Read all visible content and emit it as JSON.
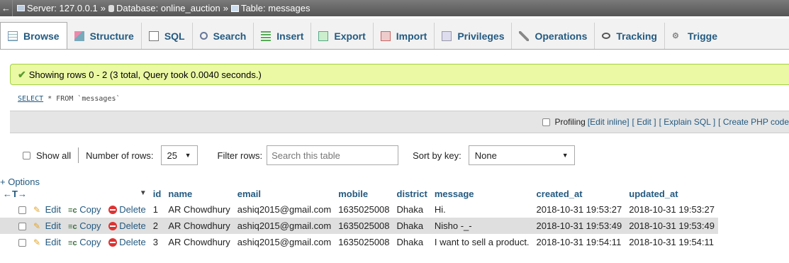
{
  "breadcrumb": {
    "back": "←",
    "server": "Server: 127.0.0.1",
    "database": "Database: online_auction",
    "table": "Table: messages",
    "sep": "»"
  },
  "tabs": [
    {
      "label": "Browse",
      "icon": "browse-icon"
    },
    {
      "label": "Structure",
      "icon": "structure-icon"
    },
    {
      "label": "SQL",
      "icon": "sql-icon"
    },
    {
      "label": "Search",
      "icon": "search-icon"
    },
    {
      "label": "Insert",
      "icon": "insert-icon"
    },
    {
      "label": "Export",
      "icon": "export-icon"
    },
    {
      "label": "Import",
      "icon": "import-icon"
    },
    {
      "label": "Privileges",
      "icon": "privileges-icon"
    },
    {
      "label": "Operations",
      "icon": "operations-icon"
    },
    {
      "label": "Tracking",
      "icon": "tracking-icon"
    },
    {
      "label": "Trigge",
      "icon": "triggers-icon"
    }
  ],
  "success": "Showing rows 0 - 2 (3 total, Query took 0.0040 seconds.)",
  "sql": {
    "select": "SELECT",
    "rest": " * FROM ",
    "table": "`messages`"
  },
  "profiling": {
    "label": "Profiling",
    "edit_inline": "[Edit inline]",
    "edit": "[ Edit ]",
    "explain": "[ Explain SQL ]",
    "php": "[ Create PHP code"
  },
  "nav": {
    "show_all": "Show all",
    "num_rows_label": "Number of rows:",
    "num_rows_value": "25",
    "filter_label": "Filter rows:",
    "filter_placeholder": "Search this table",
    "sort_label": "Sort by key:",
    "sort_value": "None"
  },
  "options": "+ Options",
  "arrows": "←T→",
  "columns": [
    "id",
    "name",
    "email",
    "mobile",
    "district",
    "message",
    "created_at",
    "updated_at"
  ],
  "actions": {
    "edit": "Edit",
    "copy": "Copy",
    "delete": "Delete"
  },
  "rows": [
    {
      "id": "1",
      "name": "AR Chowdhury",
      "email": "ashiq2015@gmail.com",
      "mobile": "1635025008",
      "district": "Dhaka",
      "message": "Hi.",
      "created_at": "2018-10-31 19:53:27",
      "updated_at": "2018-10-31 19:53:27"
    },
    {
      "id": "2",
      "name": "AR Chowdhury",
      "email": "ashiq2015@gmail.com",
      "mobile": "1635025008",
      "district": "Dhaka",
      "message": "Nisho -_-",
      "created_at": "2018-10-31 19:53:49",
      "updated_at": "2018-10-31 19:53:49"
    },
    {
      "id": "3",
      "name": "AR Chowdhury",
      "email": "ashiq2015@gmail.com",
      "mobile": "1635025008",
      "district": "Dhaka",
      "message": "I want to sell a product.",
      "created_at": "2018-10-31 19:54:11",
      "updated_at": "2018-10-31 19:54:11"
    }
  ]
}
